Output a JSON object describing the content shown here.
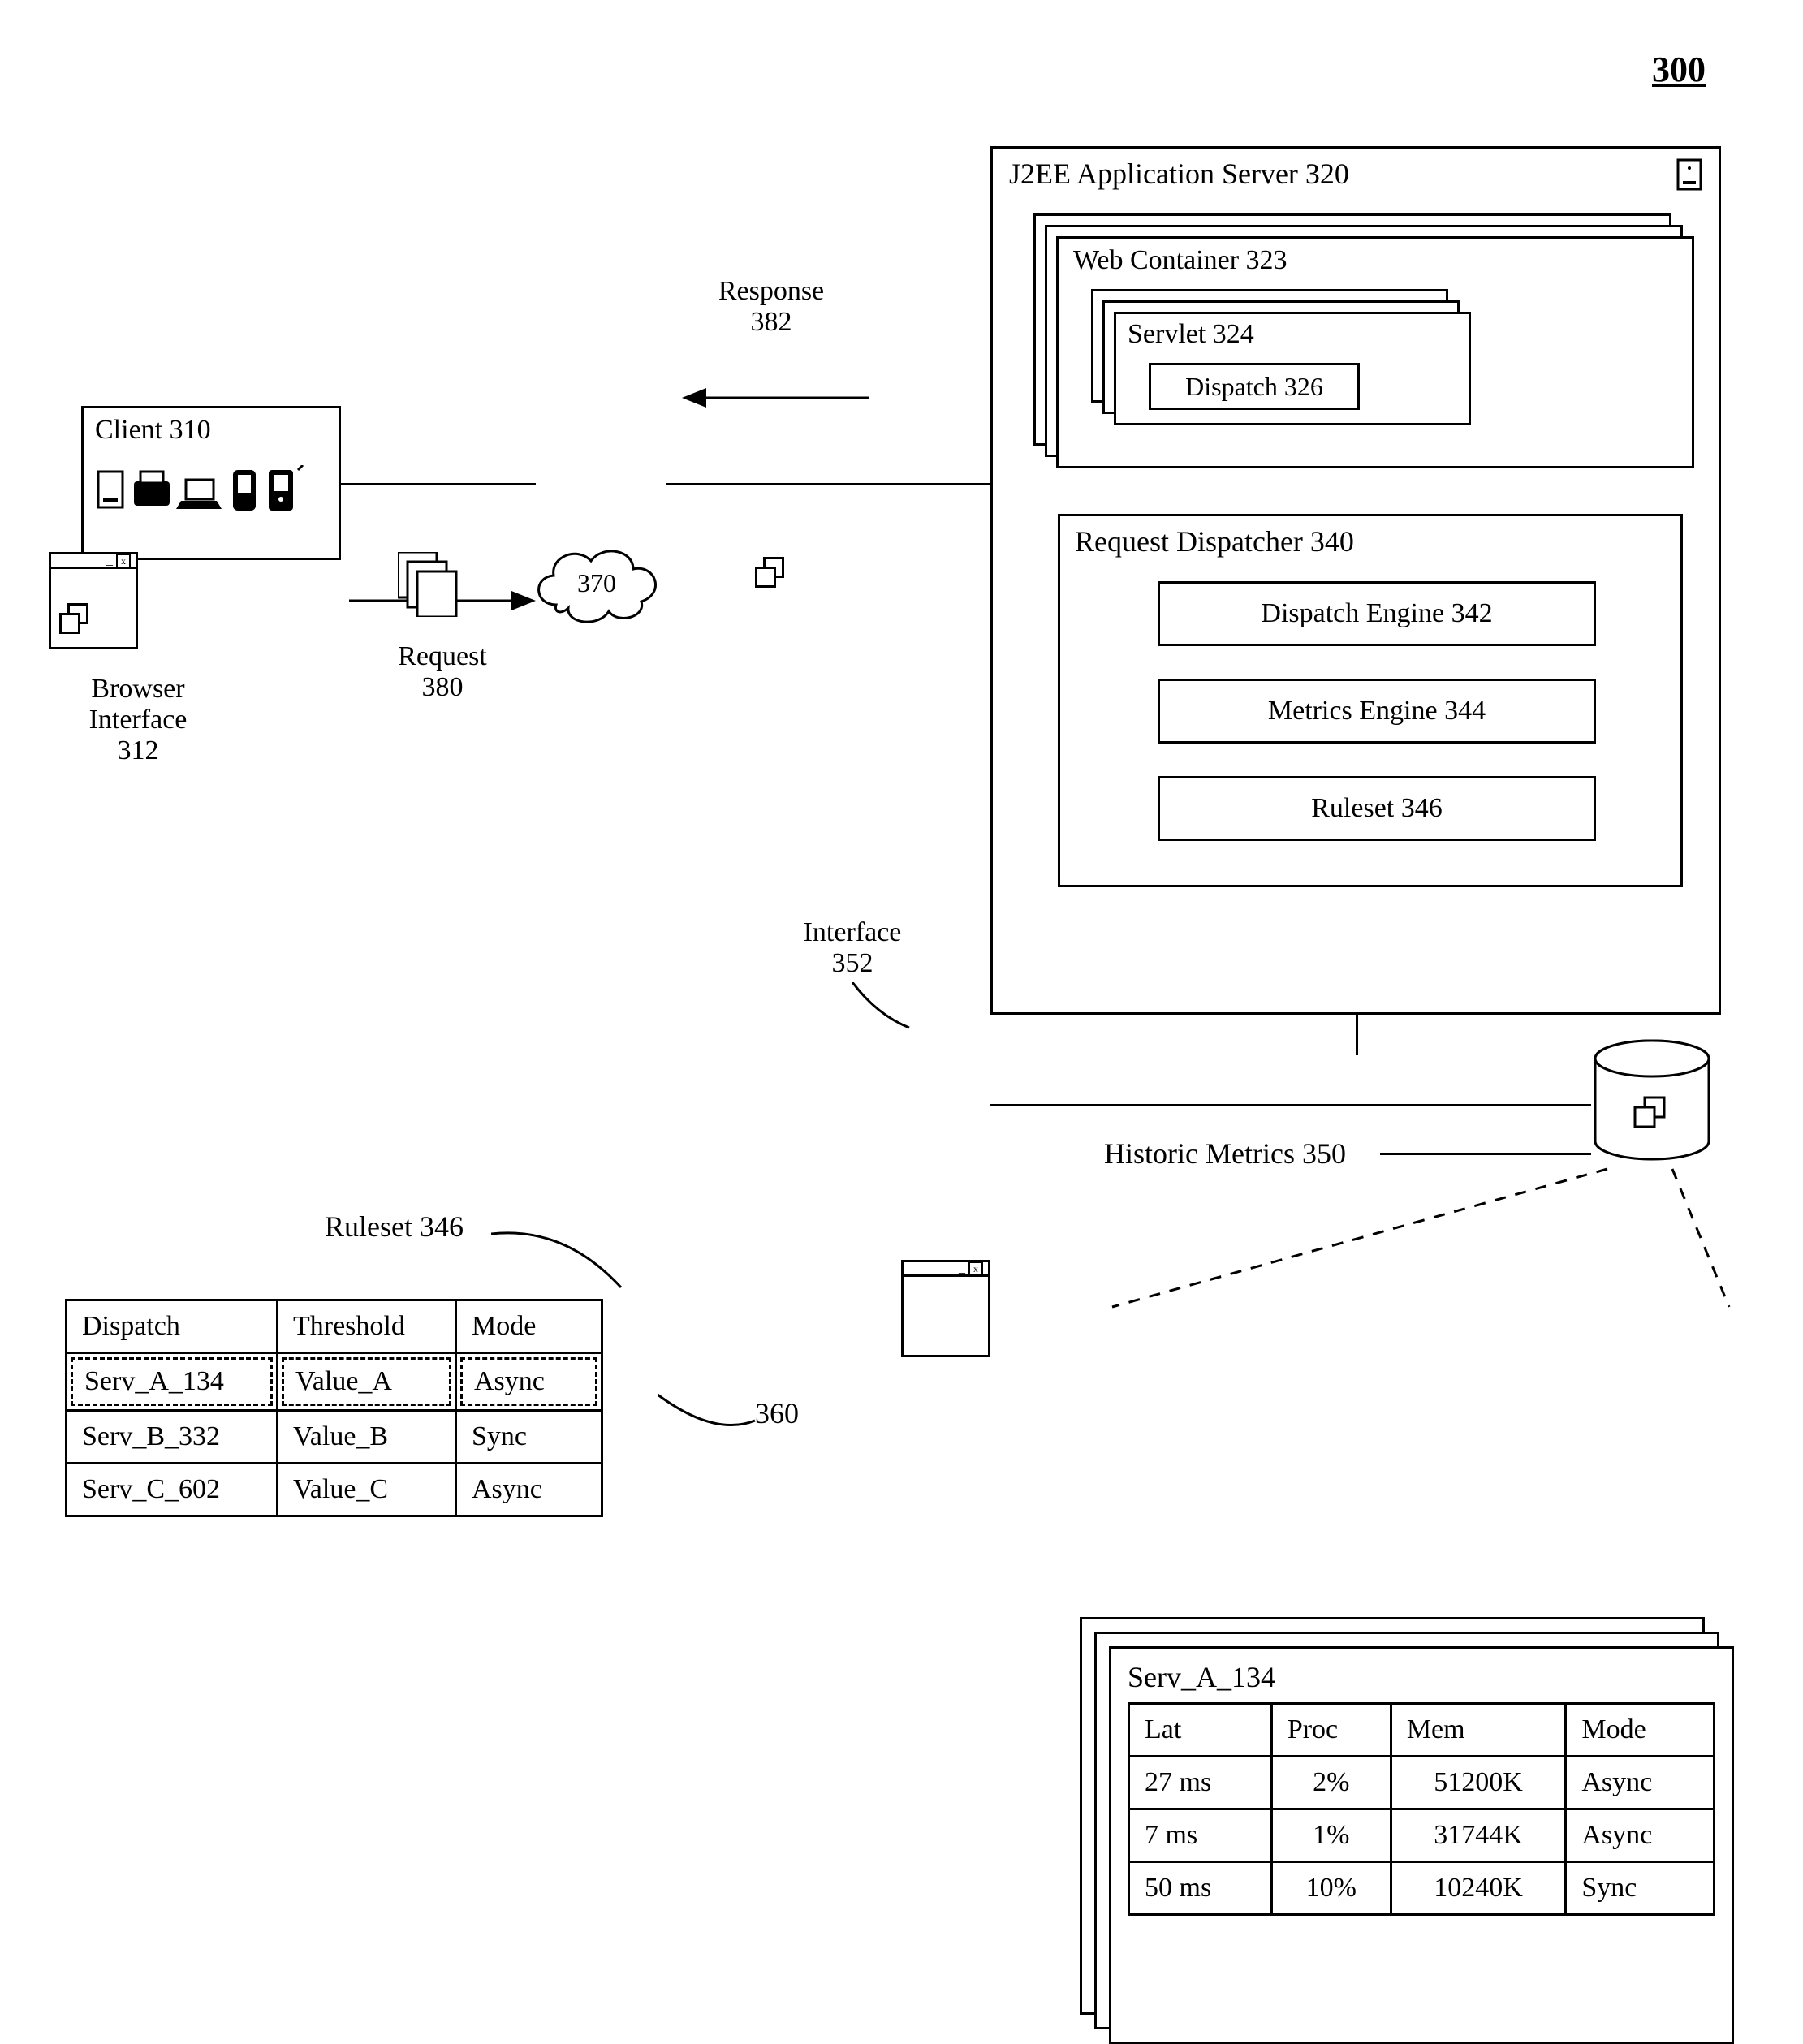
{
  "figure_number": "300",
  "client": {
    "title": "Client 310"
  },
  "browser_interface": {
    "label": "Browser\nInterface\n312"
  },
  "request": {
    "label": "Request\n380"
  },
  "response": {
    "label": "Response\n382"
  },
  "cloud": {
    "label": "370"
  },
  "server": {
    "title": "J2EE Application Server 320",
    "web_container": {
      "title": "Web Container 323"
    },
    "servlet": {
      "title": "Servlet 324"
    },
    "dispatch": {
      "title": "Dispatch 326"
    },
    "request_dispatcher": {
      "title": "Request Dispatcher 340"
    },
    "dispatch_engine": "Dispatch Engine 342",
    "metrics_engine": "Metrics Engine 344",
    "ruleset_engine": "Ruleset 346"
  },
  "interface": {
    "label": "Interface\n352"
  },
  "historic_metrics": {
    "label": "Historic Metrics 350"
  },
  "ruleset_table": {
    "title": "Ruleset 346",
    "headers": [
      "Dispatch",
      "Threshold",
      "Mode"
    ],
    "rows": [
      [
        "Serv_A_134",
        "Value_A",
        "Async"
      ],
      [
        "Serv_B_332",
        "Value_B",
        "Sync"
      ],
      [
        "Serv_C_602",
        "Value_C",
        "Async"
      ]
    ],
    "callout_360": "360"
  },
  "metrics_table": {
    "title": "Serv_A_134",
    "headers": [
      "Lat",
      "Proc",
      "Mem",
      "Mode"
    ],
    "rows": [
      [
        "27 ms",
        "2%",
        "51200K",
        "Async"
      ],
      [
        "7 ms",
        "1%",
        "31744K",
        "Async"
      ],
      [
        "50 ms",
        "10%",
        "10240K",
        "Sync"
      ]
    ]
  }
}
